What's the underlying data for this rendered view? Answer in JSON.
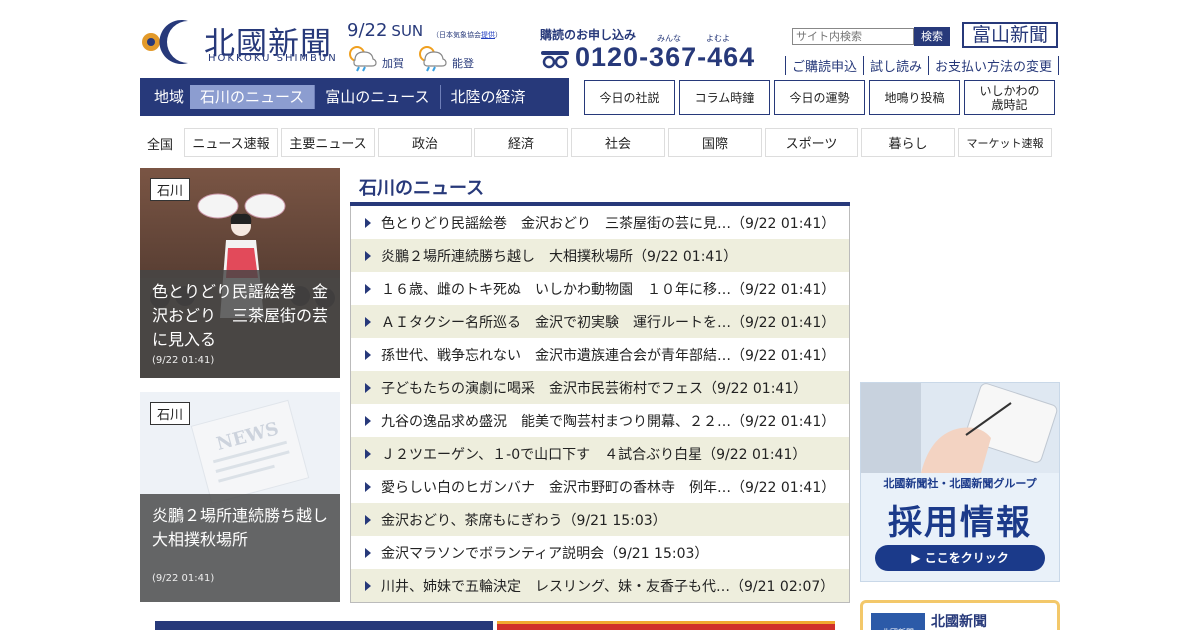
{
  "header": {
    "logo_jp": "北國新聞",
    "logo_en": "HOKKOKU SHIMBUN",
    "date": "9/22",
    "weekday": "SUN",
    "weather_source_prefix": "（日本気象協会",
    "weather_source_link": "提供",
    "weather_source_suffix": "）",
    "weather": [
      {
        "icon": "sun-rain-icon",
        "area": "加賀"
      },
      {
        "icon": "sun-rain-icon",
        "area": "能登"
      }
    ],
    "subscribe_title": "購読のお申し込み",
    "kana_1": "みんな",
    "kana_2": "よむよ",
    "phone": "0120-367-464",
    "search_placeholder": "サイト内検索",
    "search_button": "検索",
    "toyama_button": "富山新聞",
    "sub_links": [
      "ご購読申込",
      "試し読み",
      "お支払い方法の変更"
    ]
  },
  "region_nav": {
    "label": "地域",
    "items": [
      "石川のニュース",
      "富山のニュース",
      "北陸の経済"
    ],
    "active": "石川のニュース"
  },
  "top_buttons": [
    "今日の社説",
    "コラム時鐘",
    "今日の運勢",
    "地鳴り投稿",
    "いしかわの\n歳時記"
  ],
  "category_nav": {
    "label": "全国",
    "items": [
      "ニュース速報",
      "主要ニュース",
      "政治",
      "経済",
      "社会",
      "国際",
      "スポーツ",
      "暮らし",
      "マーケット速報"
    ]
  },
  "cards": [
    {
      "tag": "石川",
      "title": "色とりどり民謡絵巻　金沢おどり　三茶屋街の芸に見入る",
      "time": "(9/22 01:41)"
    },
    {
      "tag": "石川",
      "title": "炎鵬２場所連続勝ち越し　大相撲秋場所",
      "time": "(9/22 01:41)",
      "placeholder_text": "NEWS"
    }
  ],
  "news": {
    "heading": "石川のニュース",
    "items": [
      "色とりどり民謡絵巻　金沢おどり　三茶屋街の芸に見…（9/22 01:41）",
      "炎鵬２場所連続勝ち越し　大相撲秋場所（9/22 01:41）",
      "１６歳、雌のトキ死ぬ　いしかわ動物園　１０年に移…（9/22 01:41）",
      "ＡＩタクシー名所巡る　金沢で初実験　運行ルートを…（9/22 01:41）",
      "孫世代、戦争忘れない　金沢市遺族連合会が青年部結…（9/22 01:41）",
      "子どもたちの演劇に喝采　金沢市民芸術村でフェス（9/22 01:41）",
      "九谷の逸品求め盛況　能美で陶芸村まつり開幕、２２…（9/22 01:41）",
      "Ｊ２ツエーゲン、１-0で山口下す　４試合ぶり白星（9/22 01:41）",
      "愛らしい白のヒガンバナ　金沢市野町の香林寺　例年…（9/22 01:41）",
      "金沢おどり、茶席もにぎわう（9/21 15:03）",
      "金沢マラソンでボランティア説明会（9/21 15:03）",
      "川井、姉妹で五輪決定　レスリング、妹・友香子も代…（9/21 02:07）"
    ]
  },
  "ads": {
    "recruit_line1": "北國新聞社・北國新聞グループ",
    "recruit_line2": "採用情報",
    "recruit_button": "▶ ここをクリック",
    "hokkoku_box": "北國新聞",
    "hokkoku_icon_text": "北國新聞"
  },
  "colors": {
    "brand": "#27397a",
    "active_tab": "#8c9dd0",
    "row_alt": "#eeeedd"
  }
}
